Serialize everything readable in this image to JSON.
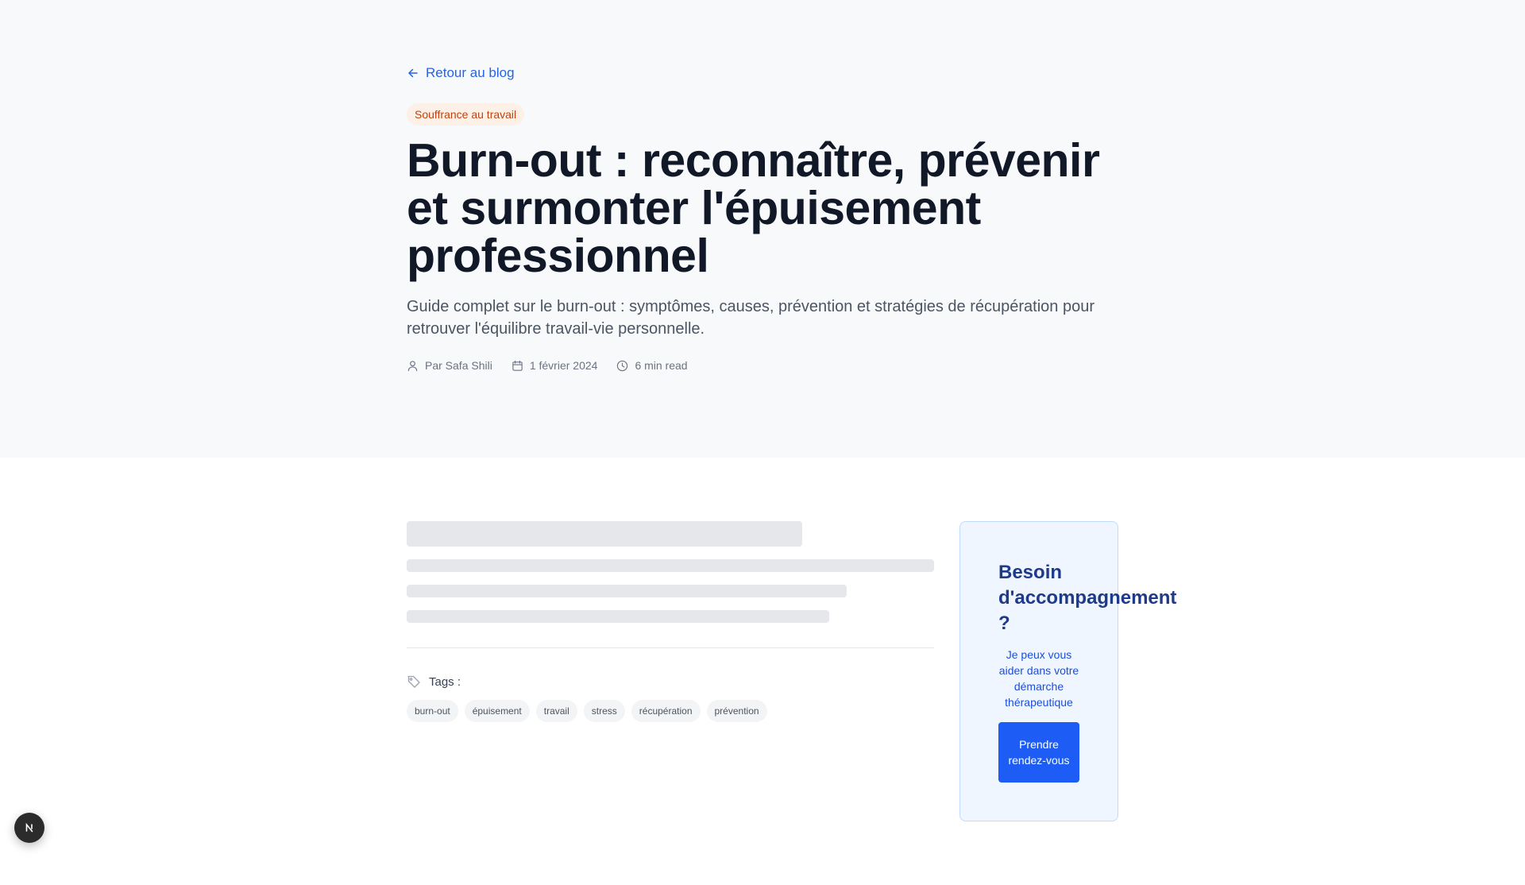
{
  "header": {
    "back_label": "Retour au blog",
    "category": "Souffrance au travail",
    "title": "Burn-out : reconnaître, prévenir et surmonter l'épuisement professionnel",
    "subtitle": "Guide complet sur le burn-out : symptômes, causes, prévention et stratégies de récupération pour retrouver l'équilibre travail-vie personnelle.",
    "meta": {
      "author": "Par Safa Shili",
      "date": "1 février 2024",
      "read_time": "6 min read"
    }
  },
  "article": {
    "tags_label": "Tags :",
    "tags": [
      "burn-out",
      "épuisement",
      "travail",
      "stress",
      "récupération",
      "prévention"
    ]
  },
  "sidebar": {
    "cta_title": "Besoin d'accompagnement ?",
    "cta_text": "Je peux vous aider dans votre démarche thérapeutique",
    "cta_button": "Prendre rendez-vous"
  },
  "colors": {
    "accent": "#2563eb",
    "button": "#1d5cf5",
    "badge_bg": "#fdf1e7",
    "badge_text": "#c2410c",
    "hero_bg": "#f8f9fb"
  },
  "icons": {
    "back": "arrow-left-icon",
    "author": "user-icon",
    "date": "calendar-icon",
    "read_time": "clock-icon",
    "tags": "tag-icon",
    "dev": "nextjs-logo-icon"
  }
}
